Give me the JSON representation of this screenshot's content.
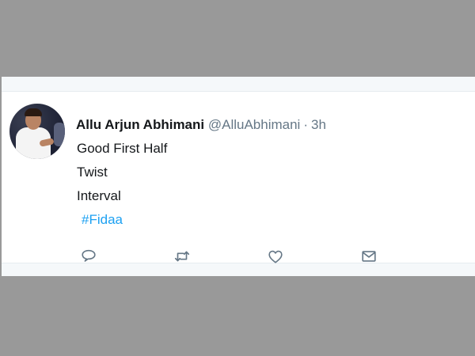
{
  "tweet": {
    "author_name": "Allu Arjun Abhimani",
    "handle": "@AlluAbhimani",
    "separator": "·",
    "time": "3h",
    "lines": [
      "Good First Half",
      "Twist",
      "Interval"
    ],
    "hashtag": "#Fidaa"
  },
  "actions": [
    {
      "name": "reply",
      "icon": "reply-icon"
    },
    {
      "name": "retweet",
      "icon": "retweet-icon"
    },
    {
      "name": "like",
      "icon": "heart-icon"
    },
    {
      "name": "direct-message",
      "icon": "envelope-icon"
    }
  ],
  "colors": {
    "outer_background": "#999999",
    "card_background": "#f5f8fa",
    "tweet_background": "#ffffff",
    "text": "#14171a",
    "secondary_text": "#657786",
    "link": "#1da1f2"
  }
}
